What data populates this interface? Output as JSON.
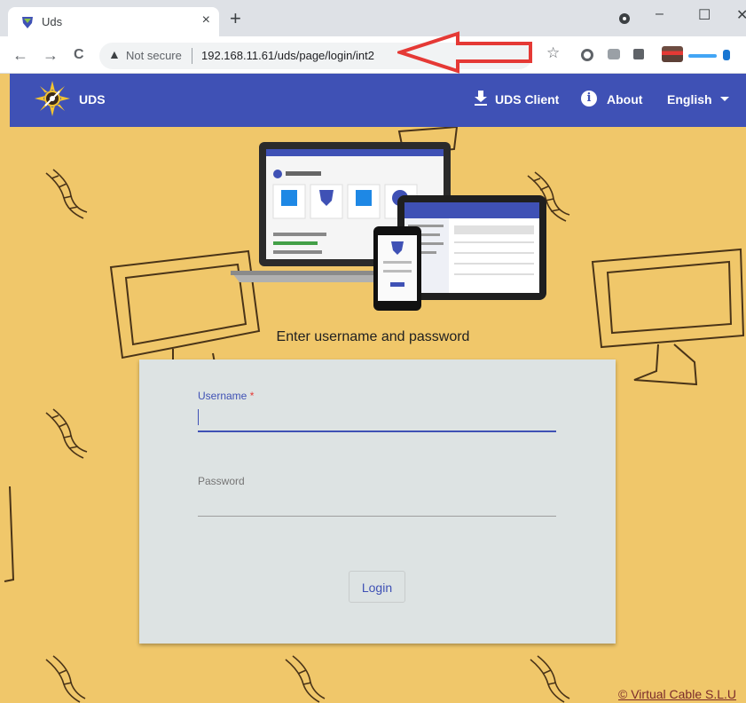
{
  "browser": {
    "tab_title": "Uds",
    "tab_close": "×",
    "new_tab": "+",
    "window_buttons": {
      "minimize": "–",
      "maximize": "☐",
      "close": "✕"
    },
    "nav": {
      "back": "←",
      "forward": "→",
      "reload": "C"
    },
    "security_label": "Not secure",
    "url": "192.168.11.61/uds/page/login/int2",
    "icons": [
      "uds-favicon-icon",
      "record-icon",
      "warning-icon",
      "star-icon",
      "opera-icon",
      "cast-icon",
      "puzzle-icon",
      "profile-icon"
    ]
  },
  "app": {
    "brand": "UDS",
    "nav": {
      "client": "UDS Client",
      "about": "About",
      "language": "English"
    },
    "colors": {
      "appbar": "#3f51b5",
      "background": "#f0c76a",
      "card": "#dde3e3",
      "accent": "#3f51b5",
      "annotation_arrow": "#e53935"
    }
  },
  "login": {
    "prompt": "Enter username and password",
    "username_label": "Username",
    "required_mark": "*",
    "password_label": "Password",
    "submit": "Login"
  },
  "footer": {
    "copyright": "© Virtual Cable S.L.U"
  }
}
